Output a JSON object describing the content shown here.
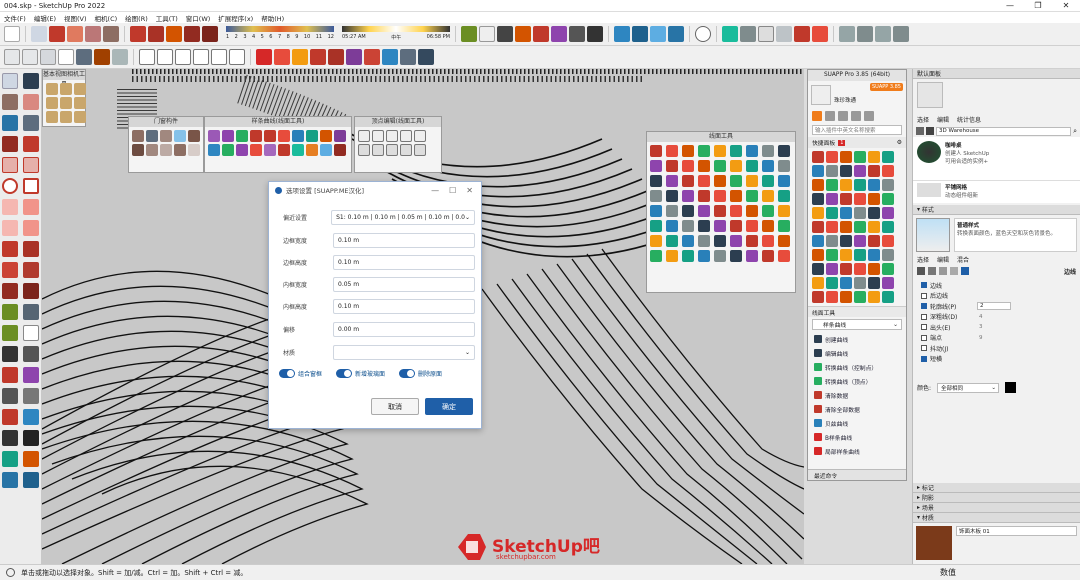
{
  "window": {
    "title": "004.skp - SketchUp Pro 2022",
    "controls": [
      "—",
      "❐",
      "✕"
    ]
  },
  "menu": [
    "文件(F)",
    "编辑(E)",
    "视图(V)",
    "相机(C)",
    "绘图(R)",
    "工具(T)",
    "窗口(W)",
    "扩展程序(x)",
    "帮助(H)"
  ],
  "shadow_bar": {
    "months": [
      "1",
      "2",
      "3",
      "4",
      "5",
      "6",
      "7",
      "8",
      "9",
      "10",
      "11",
      "12"
    ],
    "time_start": "05:27 AM",
    "time_mid": "中午",
    "time_end": "06:58 PM"
  },
  "viewport_panels": {
    "camera_tools": "基本视图相机工具",
    "door_window": "门窗构件",
    "spline": "样条曲线(线面工具)",
    "vertex": "顶点编辑(线面工具)",
    "curve_tools": "线面工具"
  },
  "dialog": {
    "title": "选项设置 [SUAPP.ME汉化]",
    "controls": [
      "—",
      "☐",
      "✕"
    ],
    "rows": [
      {
        "label": "偏近设置",
        "value": "S1: 0.10 m | 0.10 m | 0.05 m | 0.10 m | 0.0"
      },
      {
        "label": "边框宽度",
        "value": "0.10 m"
      },
      {
        "label": "边框高度",
        "value": "0.10 m"
      },
      {
        "label": "内框宽度",
        "value": "0.05 m"
      },
      {
        "label": "内框高度",
        "value": "0.10 m"
      },
      {
        "label": "偏移",
        "value": "0.00 m"
      },
      {
        "label": "材质",
        "value": ""
      }
    ],
    "toggles": [
      "组合窗框",
      "新增玻璃面",
      "删除原面"
    ],
    "cancel": "取消",
    "ok": "确定"
  },
  "suapp": {
    "title": "SUAPP Pro 3.85 (64bit)",
    "login": "SUAPP 3.85",
    "user": "珠珍珠通",
    "search_placeholder": "输入插件中英文名称搜索",
    "quick_panel": "快捷面板",
    "quick_badge": "1",
    "line_tools": "线面工具",
    "spline_dropdown": "样条曲线",
    "items": [
      "创建曲线",
      "编辑曲线",
      "转换曲线（控制点）",
      "转换曲线（顶点）",
      "清除数据",
      "清除全部数据",
      "贝兹曲线",
      "B样条曲线",
      "局部样条曲线"
    ],
    "footer": "最近命令"
  },
  "tray": {
    "title": "默认面板",
    "tabs_top": [
      "选择",
      "编辑",
      "统计信息"
    ],
    "warehouse": "3D Warehouse",
    "comp1_title": "咖啡桌",
    "comp1_desc": "创建人 SketchUp\n可用合适的实例+",
    "comp2_title": "平铺网格",
    "comp2_desc": "动态组件组新",
    "styles_head": "样式",
    "style_name": "普通样式",
    "style_desc": "转换表面颜色，蓝色天空和灰色背景色。",
    "style_tabs": [
      "选择",
      "编辑",
      "混合"
    ],
    "edges_label": "边线",
    "edge_opts": [
      {
        "label": "边线",
        "on": true,
        "value": ""
      },
      {
        "label": "后边线",
        "on": false,
        "value": ""
      },
      {
        "label": "轮廓线(P)",
        "on": true,
        "value": "2"
      },
      {
        "label": "深粗线(D)",
        "on": false,
        "value": "4"
      },
      {
        "label": "出头(E)",
        "on": false,
        "value": "3"
      },
      {
        "label": "端点",
        "on": false,
        "value": "9"
      },
      {
        "label": "抖动(J)",
        "on": false,
        "value": ""
      },
      {
        "label": "短横",
        "on": true,
        "value": ""
      }
    ],
    "color_label": "颜色:",
    "color_value": "全部相同",
    "collapsed": [
      "标记",
      "阴影",
      "场景"
    ],
    "materials_head": "材质",
    "material_name": "饰面木板 01"
  },
  "status": {
    "hint": "单击或拖动以选择对象。Shift = 加/减。Ctrl = 加。Shift + Ctrl = 减。",
    "measure_label": "数值"
  },
  "watermark": {
    "brand": "SketchUp吧",
    "url": "sketchupbar.com"
  },
  "colors": {
    "accent": "#1f5fa8",
    "brand_red": "#d62828",
    "suapp_orange": "#f07c1b"
  }
}
